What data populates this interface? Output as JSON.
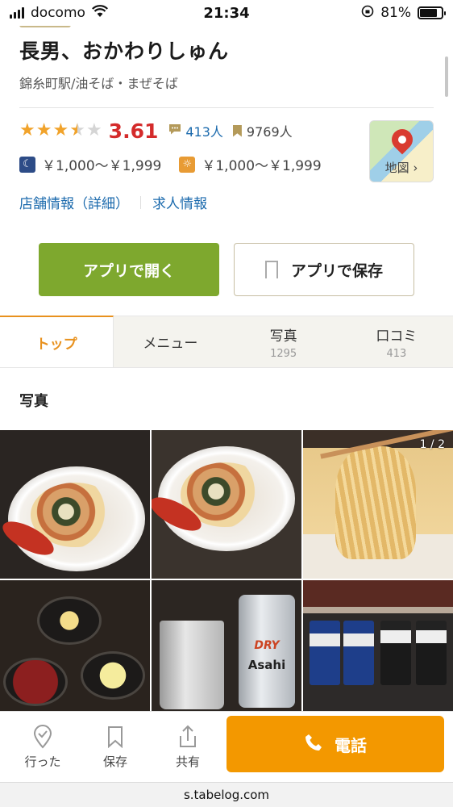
{
  "status_bar": {
    "carrier": "docomo",
    "time": "21:34",
    "battery": "81%",
    "battery_level": 0.81
  },
  "shop": {
    "name": "長男、おかわりしゅん",
    "genre": "錦糸町駅/油そば・まぜそば",
    "rating": {
      "stars": 3.5,
      "score": "3.61"
    },
    "review_count": "413人",
    "bookmark_count": "9769人",
    "price_dinner": "￥1,000～￥1,999",
    "price_lunch": "￥1,000～￥1,999",
    "map_label": "地図",
    "links": [
      "店舗情報（詳細）",
      "求人情報"
    ]
  },
  "actions": {
    "open_app": "アプリで開く",
    "save_app": "アプリで保存"
  },
  "tabs": [
    {
      "label": "トップ",
      "count": ""
    },
    {
      "label": "メニュー",
      "count": ""
    },
    {
      "label": "写真",
      "count": "1295"
    },
    {
      "label": "口コミ",
      "count": "413"
    }
  ],
  "section_title": "写真",
  "photos": {
    "counter": "1 / 2",
    "can_label": "DRY",
    "can_brand": "Asahi"
  },
  "bottom_bar": {
    "went": "行った",
    "save": "保存",
    "share": "共有",
    "phone": "電話"
  },
  "url": "s.tabelog.com",
  "colors": {
    "accent_orange": "#f39800",
    "green_button": "#7ea82e",
    "score_red": "#d42b2b",
    "link_blue": "#1b6aad"
  }
}
